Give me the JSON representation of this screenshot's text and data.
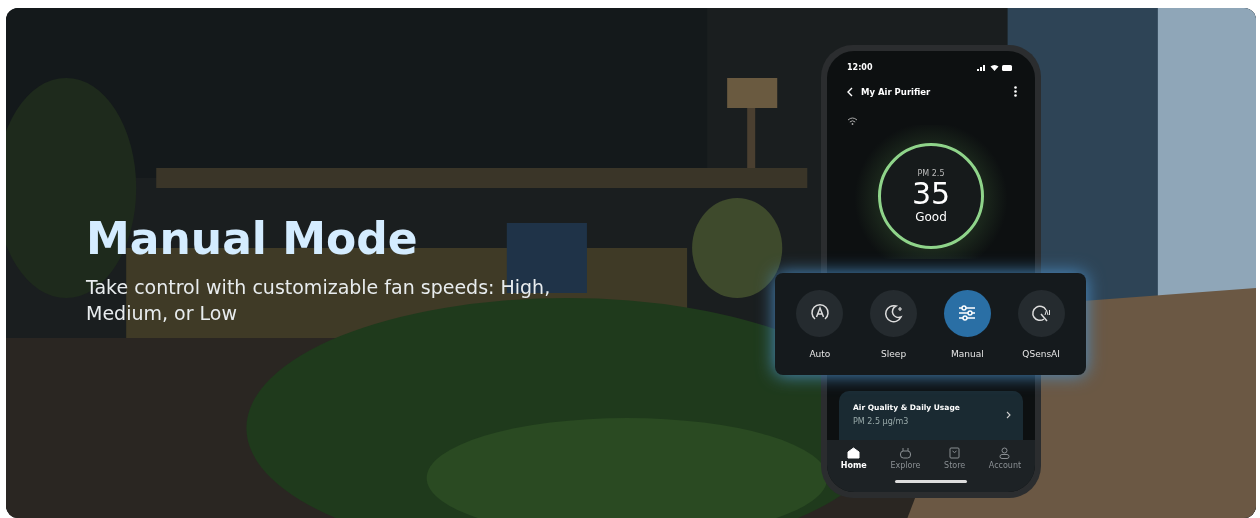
{
  "banner": {
    "title": "Manual Mode",
    "subtitle": "Take control with customizable fan speeds: High, Medium, or Low"
  },
  "phone": {
    "time": "12:00",
    "title": "My Air Purifier",
    "reading": {
      "label": "PM 2.5",
      "value": "35",
      "status": "Good"
    },
    "modes": [
      {
        "label": "Auto",
        "kind": "auto",
        "selected": false
      },
      {
        "label": "Sleep",
        "kind": "sleep",
        "selected": false
      },
      {
        "label": "Manual",
        "kind": "manual",
        "selected": true
      },
      {
        "label": "QSensAI",
        "kind": "ai",
        "selected": false
      }
    ],
    "card": {
      "title": "Air Quality & Daily Usage",
      "subtitle": "PM 2.5 µg/m3"
    },
    "nav": [
      {
        "label": "Home",
        "kind": "home",
        "selected": true
      },
      {
        "label": "Explore",
        "kind": "explore",
        "selected": false
      },
      {
        "label": "Store",
        "kind": "store",
        "selected": false
      },
      {
        "label": "Account",
        "kind": "account",
        "selected": false
      }
    ]
  }
}
